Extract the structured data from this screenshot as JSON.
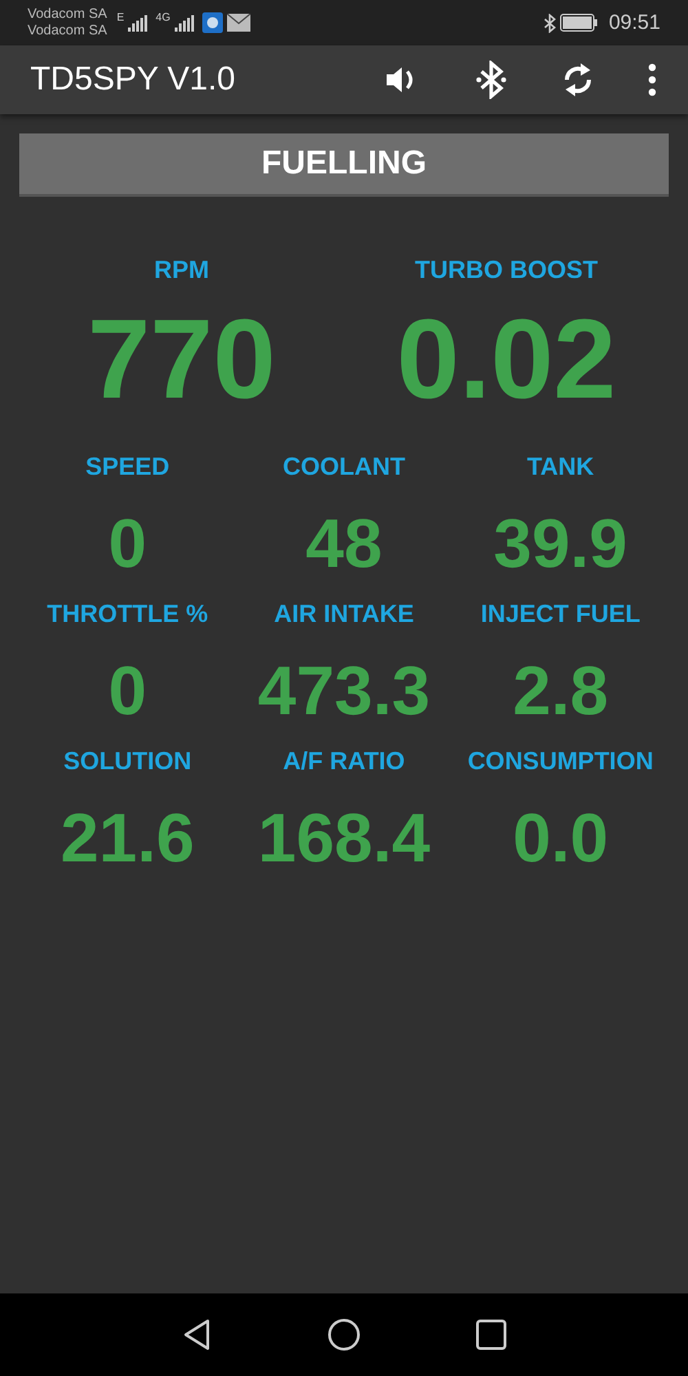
{
  "status_bar": {
    "carriers": [
      "Vodacom SA",
      "Vodacom SA"
    ],
    "network_labels": [
      "E",
      "4G"
    ],
    "time": "09:51"
  },
  "app_bar": {
    "title": "TD5SPY V1.0"
  },
  "section": {
    "title": "FUELLING"
  },
  "rows": [
    {
      "kind": "large",
      "gauges": [
        {
          "label": "RPM",
          "value": "770"
        },
        {
          "label": "TURBO BOOST",
          "value": "0.02"
        }
      ]
    },
    {
      "kind": "small",
      "gauges": [
        {
          "label": "SPEED",
          "value": "0"
        },
        {
          "label": "COOLANT",
          "value": "48"
        },
        {
          "label": "TANK",
          "value": "39.9"
        }
      ]
    },
    {
      "kind": "small",
      "gauges": [
        {
          "label": "THROTTLE %",
          "value": "0"
        },
        {
          "label": "AIR INTAKE",
          "value": "473.3"
        },
        {
          "label": "INJECT FUEL",
          "value": "2.8"
        }
      ]
    },
    {
      "kind": "small",
      "gauges": [
        {
          "label": "SOLUTION",
          "value": "21.6"
        },
        {
          "label": "A/F RATIO",
          "value": "168.4"
        },
        {
          "label": "CONSUMPTION",
          "value": "0.0"
        }
      ]
    }
  ]
}
